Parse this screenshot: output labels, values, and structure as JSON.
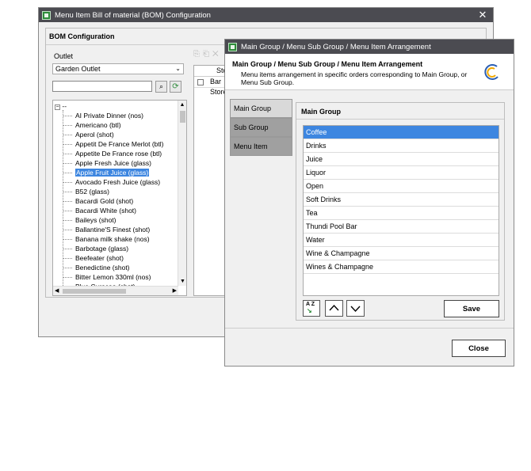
{
  "bom_window": {
    "title": "Menu Item Bill of material (BOM) Configuration",
    "section_title": "BOM Configuration",
    "outlet_label": "Outlet",
    "outlet_value": "Garden Outlet",
    "search_value": "",
    "tree_root": "--",
    "tree_items": [
      "AI Private Dinner (nos)",
      "Americano (btl)",
      "Aperol (shot)",
      "Appetit De France Merlot (btl)",
      "Appetite De France rose (btl)",
      "Apple Fresh Juice (glass)",
      "Apple Fruit Juice (glass)",
      "Avocado Fresh Juice (glass)",
      "B52 (glass)",
      "Bacardi Gold (shot)",
      "Bacardi White (shot)",
      "Baileys (shot)",
      "Ballantine'S Finest (shot)",
      "Banana milk shake  (nos)",
      "Barbotage (glass)",
      "Beefeater (shot)",
      "Benedictine (shot)",
      "Bitter Lemon 330ml (nos)",
      "Blue Curacao (shot)"
    ],
    "selected_index": 6,
    "store_header": "Store",
    "store_row": "Bar Store"
  },
  "arrange_window": {
    "title": "Main Group / Menu Sub Group / Menu Item Arrangement",
    "heading": "Main Group / Menu Sub Group / Menu Item Arrangement",
    "description": "Menu items arrangement in specific orders corresponding to Main Group, or Menu Sub Group.",
    "tabs": [
      "Main Group",
      "Sub Group",
      "Menu Item"
    ],
    "panel_title": "Main Group",
    "items": [
      "Coffee",
      "Drinks",
      "Juice",
      "Liquor",
      "Open",
      "Soft Drinks",
      "Tea",
      "Thundi Pool Bar",
      "Water",
      "Wine & Champagne",
      "Wines & Champagne"
    ],
    "selected_index": 0,
    "sort_icon_text": "A Z",
    "save_label": "Save",
    "close_label": "Close"
  },
  "colors": {
    "titlebar": "#4b4b51",
    "selection": "#3d86e0",
    "tab_active": "#d9d9d9",
    "tab_inactive": "#a0a0a0"
  }
}
